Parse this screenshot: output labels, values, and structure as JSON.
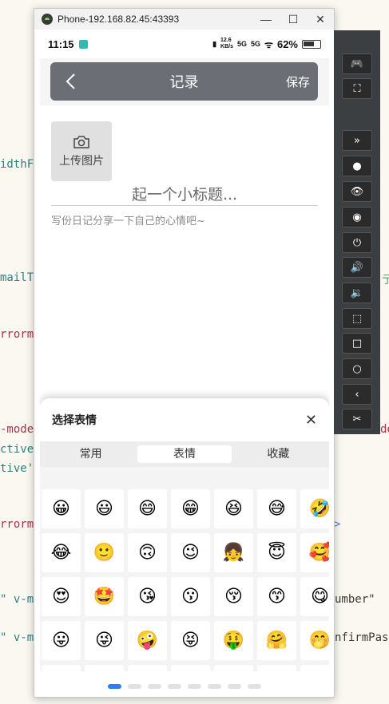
{
  "background_code": {
    "lines": [
      "idthF",
      "mailT",
      "rrorm",
      "-mode",
      "ctive",
      "tive'",
      "rrorm",
      "\" v-m",
      "\" v-m"
    ],
    "right_fragments": [
      "亍",
      "de",
      ">",
      "umber\"",
      "nfirmPas"
    ]
  },
  "window": {
    "title": "Phone-192.168.82.45:43393",
    "minimize_symbol": "—",
    "maximize_symbol": "☐",
    "close_symbol": "✕"
  },
  "statusbar": {
    "time": "11:15",
    "net_speed_top": "12.6",
    "net_speed_bottom": "KB/s",
    "sig1": "5G",
    "sig2": "5G",
    "battery": "62%"
  },
  "appbar": {
    "title": "记录",
    "save": "保存"
  },
  "editor": {
    "upload_label": "上传图片",
    "title_placeholder": "起一个小标题...",
    "body_placeholder": "写份日记分享一下自己的心情吧~"
  },
  "emoji_sheet": {
    "title": "选择表情",
    "close": "✕",
    "tabs": [
      "常用",
      "表情",
      "收藏"
    ],
    "active_tab": 1,
    "emojis": [
      "😀",
      "😃",
      "😄",
      "😁",
      "😆",
      "😅",
      "🤣",
      "😂",
      "🙂",
      "🙃",
      "😉",
      "👧",
      "😇",
      "🥰",
      "😍",
      "🤩",
      "😘",
      "😗",
      "😚",
      "😙",
      "😋",
      "😛",
      "😜",
      "🤪",
      "😝",
      "🤑",
      "🤗",
      "🤭",
      "",
      "",
      "",
      "",
      "",
      "",
      ""
    ],
    "page_count": 8,
    "active_page": 0
  },
  "side_toolbar": {
    "buttons": [
      "🎮",
      "⛶",
      "»",
      "●",
      "👁",
      "◉",
      "⏻",
      "🔊",
      "🔉",
      "⬚",
      "□",
      "○",
      "‹",
      "✂"
    ]
  },
  "colors": {
    "appbar_bg": "#6b6f75",
    "active_page_dot": "#2e7cf6",
    "sidebar_bg": "#3c3f41"
  }
}
